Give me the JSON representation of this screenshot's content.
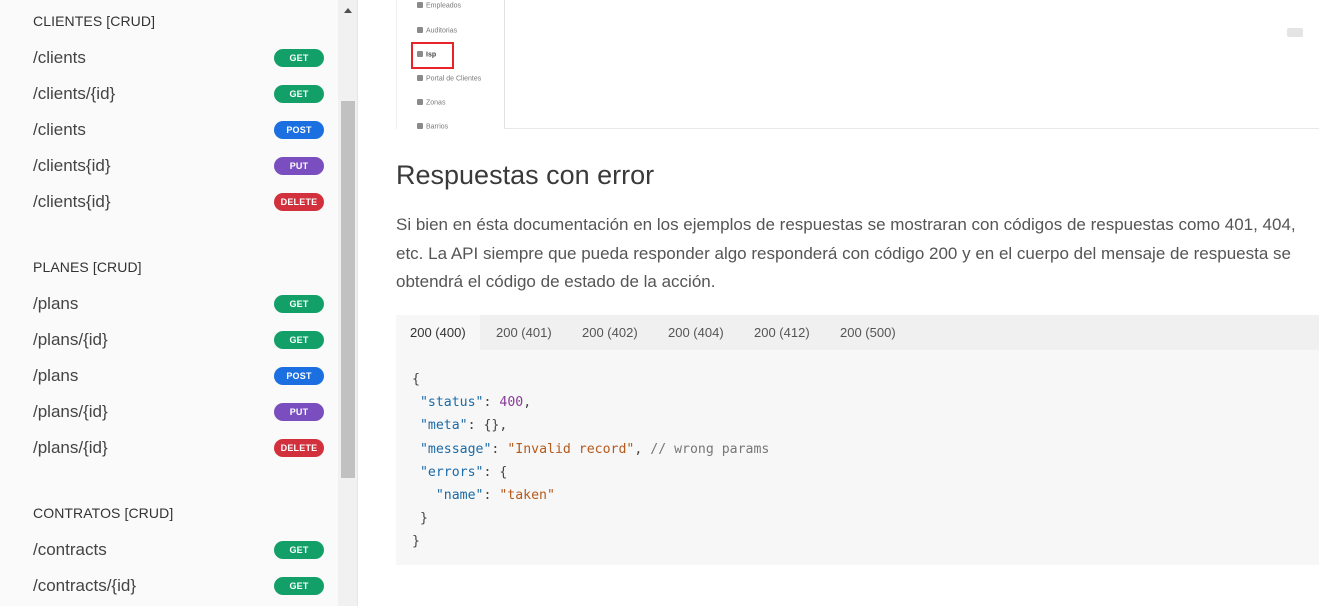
{
  "sidebar": {
    "sections": [
      {
        "title": "CLIENTES [CRUD]",
        "items": [
          {
            "path": "/clients",
            "method": "GET"
          },
          {
            "path": "/clients/{id}",
            "method": "GET"
          },
          {
            "path": "/clients",
            "method": "POST"
          },
          {
            "path": "/clients{id}",
            "method": "PUT"
          },
          {
            "path": "/clients{id}",
            "method": "DELETE"
          }
        ]
      },
      {
        "title": "PLANES [CRUD]",
        "items": [
          {
            "path": "/plans",
            "method": "GET"
          },
          {
            "path": "/plans/{id}",
            "method": "GET"
          },
          {
            "path": "/plans",
            "method": "POST"
          },
          {
            "path": "/plans/{id}",
            "method": "PUT"
          },
          {
            "path": "/plans/{id}",
            "method": "DELETE"
          }
        ]
      },
      {
        "title": "CONTRATOS [CRUD]",
        "items": [
          {
            "path": "/contracts",
            "method": "GET"
          },
          {
            "path": "/contracts/{id}",
            "method": "GET"
          }
        ]
      }
    ],
    "method_colors": {
      "GET": "#13a068",
      "POST": "#1c6fe0",
      "PUT": "#7a4ebe",
      "DELETE": "#d2303c"
    }
  },
  "embedded_screenshot": {
    "menu": [
      {
        "label": "Empleados",
        "icon": "user-icon"
      },
      {
        "label": "Auditorias",
        "icon": "eye-icon"
      },
      {
        "label": "Isp",
        "icon": "bank-icon"
      },
      {
        "label": "Portal de Clientes",
        "icon": "users-icon"
      },
      {
        "label": "Zonas",
        "icon": "map-icon"
      },
      {
        "label": "Barrios",
        "icon": "map-icon"
      }
    ],
    "highlighted": "Isp",
    "highlight_color": "#e8232a"
  },
  "content": {
    "heading": "Respuestas con error",
    "paragraph": "Si bien en ésta documentación en los ejemplos de respuestas se mostraran con códigos de respuestas como 401, 404, etc. La API siempre que pueda responder algo responderá con código 200 y en el cuerpo del mensaje de respuesta se obtendrá el código de estado de la acción.",
    "tabs": [
      "200 (400)",
      "200 (401)",
      "200 (402)",
      "200 (404)",
      "200 (412)",
      "200 (500)"
    ],
    "active_tab": "200 (400)",
    "code": {
      "status_key": "\"status\"",
      "status_value": "400",
      "meta_key": "\"meta\"",
      "meta_value": "{}",
      "message_key": "\"message\"",
      "message_value": "\"Invalid record\"",
      "message_comment": "// wrong params",
      "errors_key": "\"errors\"",
      "name_key": "\"name\"",
      "name_value": "\"taken\""
    }
  }
}
